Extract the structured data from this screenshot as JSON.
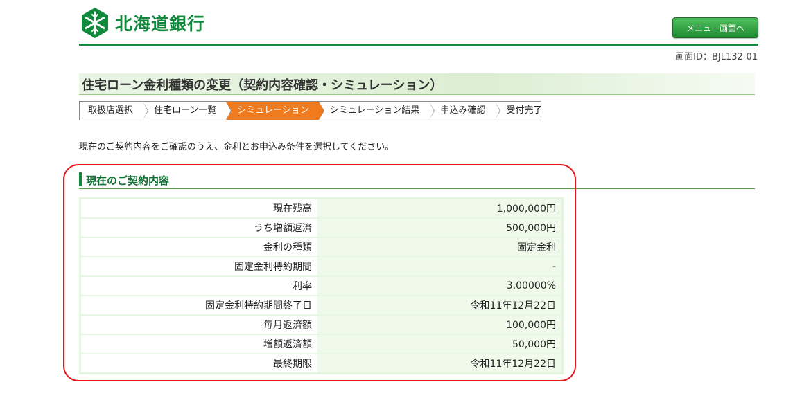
{
  "header": {
    "bank_name": "北海道銀行",
    "menu_button": "メニュー画面へ",
    "screen_id": "画面ID：BJL132-01"
  },
  "page": {
    "title": "住宅ローン金利種類の変更（契約内容確認・シミュレーション）",
    "intro": "現在のご契約内容をご確認のうえ、金利とお申込み条件を選択してください。"
  },
  "steps": [
    {
      "label": "取扱店選択",
      "active": false
    },
    {
      "label": "住宅ローン一覧",
      "active": false
    },
    {
      "label": "シミュレーション",
      "active": true
    },
    {
      "label": "シミュレーション結果",
      "active": false
    },
    {
      "label": "申込み確認",
      "active": false
    },
    {
      "label": "受付完了",
      "active": false
    }
  ],
  "contract": {
    "heading": "現在のご契約内容",
    "rows": [
      {
        "label": "現在残高",
        "value": "1,000,000円"
      },
      {
        "label": "うち増額返済",
        "value": "500,000円"
      },
      {
        "label": "金利の種類",
        "value": "固定金利"
      },
      {
        "label": "固定金利特約期間",
        "value": "-"
      },
      {
        "label": "利率",
        "value": "3.00000%"
      },
      {
        "label": "固定金利特約期間終了日",
        "value": "令和11年12月22日"
      },
      {
        "label": "毎月返済額",
        "value": "100,000円"
      },
      {
        "label": "増額返済額",
        "value": "50,000円"
      },
      {
        "label": "最終期限",
        "value": "令和11年12月22日"
      }
    ]
  },
  "colors": {
    "brand_green": "#0f8a3c",
    "active_step": "#f07a1e",
    "highlight_border": "#e8141a"
  }
}
